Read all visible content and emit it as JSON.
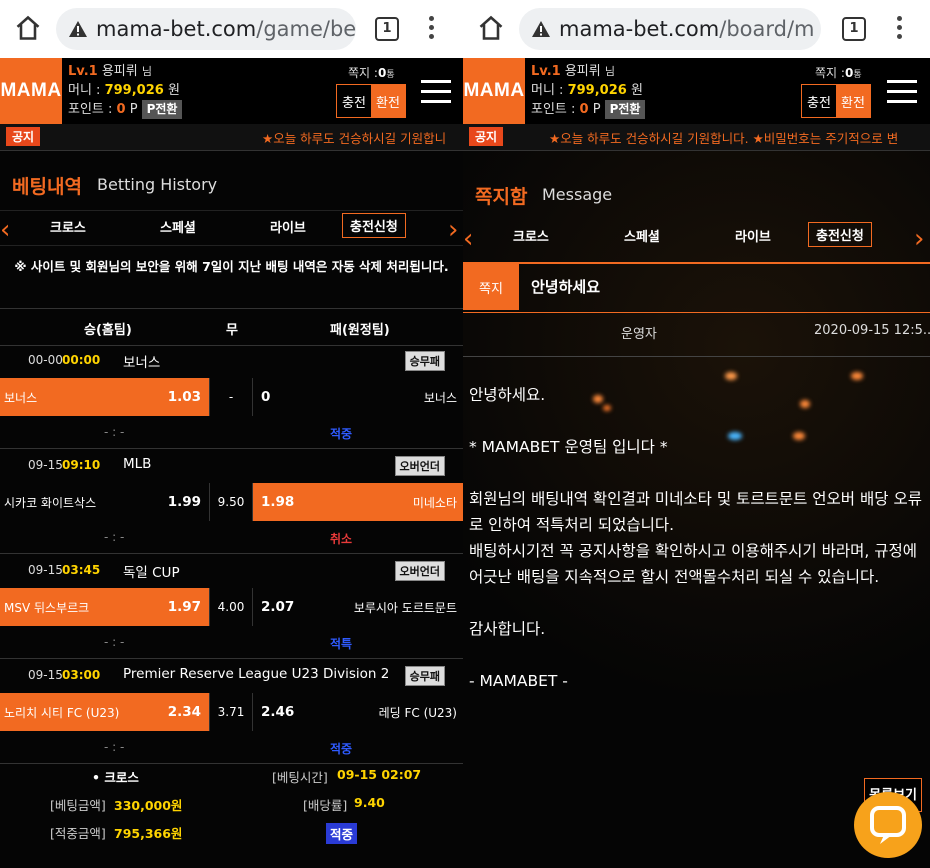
{
  "left": {
    "browser": {
      "url_domain": "mama-bet.com",
      "url_path": "/game/be",
      "tab_count": "1"
    },
    "header": {
      "logo": "MAMA",
      "level": "Lv.1",
      "nickname": "용피뤼",
      "honorific": "님",
      "money_label": "머니 :",
      "money_value": "799,026",
      "money_unit": "원",
      "points_label": "포인트 :",
      "points_value": "0",
      "points_unit": "P",
      "points_button": "P전환",
      "msg_label": "쪽지 :",
      "msg_count": "0",
      "msg_unit": "통",
      "charge_button": "충전",
      "exchange_button": "환전"
    },
    "notice": {
      "tag": "공지",
      "text": "★오늘 하루도 건승하시길 기원합니"
    },
    "section": {
      "title_ko": "베팅내역",
      "title_en": "Betting History"
    },
    "tabs": [
      "크로스",
      "스페셜",
      "라이브",
      "충전신청"
    ],
    "warning": "※ 사이트 및 회원님의 보안을 위해 7일이 지난 배팅 내역은 자동 삭제 처리됩니다.",
    "columns": {
      "home": "승(홈팀)",
      "draw": "무",
      "away": "패(원정팀)"
    },
    "games": [
      {
        "date": "00-00",
        "time": "00:00",
        "league": "보너스",
        "type": "승무패",
        "home": "보너스",
        "home_odds": "1.03",
        "draw": "-",
        "away": "보너스",
        "away_odds": "0",
        "score": "- : -",
        "result": "적중",
        "pick": "home"
      },
      {
        "date": "09-15",
        "time": "09:10",
        "league": "MLB",
        "type": "오버언더",
        "home": "시카코 화이트삭스",
        "home_odds": "1.99",
        "draw": "9.50",
        "away": "미네소타",
        "away_odds": "1.98",
        "score": "- : -",
        "result": "취소",
        "pick": "away"
      },
      {
        "date": "09-15",
        "time": "03:45",
        "league": "독일 CUP",
        "type": "오버언더",
        "home": "MSV 뒤스부르크",
        "home_odds": "1.97",
        "draw": "4.00",
        "away": "보루시아 도르트문트",
        "away_odds": "2.07",
        "score": "- : -",
        "result": "적특",
        "pick": "home"
      },
      {
        "date": "09-15",
        "time": "03:00",
        "league": "Premier Reserve League U23 Division 2",
        "type": "승무패",
        "home": "노리치 시티 FC (U23)",
        "home_odds": "2.34",
        "draw": "3.71",
        "away": "레딩 FC (U23)",
        "away_odds": "2.46",
        "score": "- : -",
        "result": "적중",
        "pick": "home"
      }
    ],
    "summary": {
      "kind": "• 크로스",
      "bet_time_label": "[베팅시간]",
      "bet_time": "09-15 02:07",
      "bet_amount_label": "[베팅금액]",
      "bet_amount": "330,000원",
      "odds_label": "[배당률]",
      "odds": "9.40",
      "win_amount_label": "[적중금액]",
      "win_amount": "795,366원",
      "status": "적중"
    }
  },
  "right": {
    "browser": {
      "url_domain": "mama-bet.com",
      "url_path": "/board/m",
      "tab_count": "1"
    },
    "header": {
      "logo": "MAMA",
      "level": "Lv.1",
      "nickname": "용피뤼",
      "honorific": "님",
      "money_label": "머니 :",
      "money_value": "799,026",
      "money_unit": "원",
      "points_label": "포인트 :",
      "points_value": "0",
      "points_unit": "P",
      "points_button": "P전환",
      "msg_label": "쪽지 :",
      "msg_count": "0",
      "msg_unit": "통",
      "charge_button": "충전",
      "exchange_button": "환전"
    },
    "notice": {
      "tag": "공지",
      "text": "★오늘 하루도 건승하시길 기원합니다. ★비밀번호는 주기적으로 변"
    },
    "section": {
      "title_ko": "쪽지함",
      "title_en": "Message"
    },
    "tabs": [
      "크로스",
      "스페셜",
      "라이브",
      "충전신청"
    ],
    "message": {
      "tag": "쪽지",
      "title": "안녕하세요",
      "from": "운영자",
      "date": "2020-09-15 12:5...",
      "lines": [
        "안녕하세요.",
        "",
        "* MAMABET 운영팀 입니다 *",
        "",
        "회원님의 배팅내역 확인결과 미네소타 및 토르트문트 언오버 배당 오류로 인하여 적특처리 되었습니다.",
        "배팅하시기전 꼭 공지사항을 확인하시고 이용해주시기 바라며, 규정에 어긋난 배팅을 지속적으로 할시 전액몰수처리 되실 수 있습니다.",
        "",
        "감사합니다.",
        "",
        "- MAMABET -"
      ],
      "list_button": "목록보기"
    }
  },
  "colors": {
    "accent": "#f26a21",
    "money": "#ffd400",
    "win": "#2f5bff",
    "cancel": "#e83a3a"
  }
}
